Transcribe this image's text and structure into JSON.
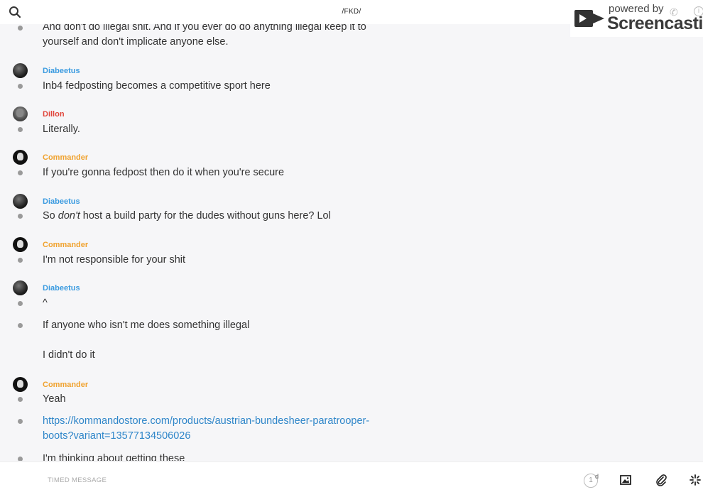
{
  "header": {
    "title": "/FKD/",
    "search_icon": "search-icon"
  },
  "watermark": {
    "powered_by": "powered by",
    "brand": "Screencastify"
  },
  "messages": [
    {
      "type": "text",
      "text": "And don't do illegal shit. And if you ever do do anything illegal keep it to yourself and don't implicate anyone else."
    },
    {
      "type": "author",
      "name": "Diabeetus",
      "color": "#3b9be0"
    },
    {
      "type": "text",
      "text": "Inb4 fedposting becomes a competitive sport here"
    },
    {
      "type": "author",
      "name": "Dillon",
      "color": "#e0453b"
    },
    {
      "type": "text",
      "text": "Literally."
    },
    {
      "type": "author",
      "name": "Commander",
      "color": "#f0a22e"
    },
    {
      "type": "text",
      "text": "If you're gonna fedpost then do it when you're secure"
    },
    {
      "type": "author",
      "name": "Diabeetus",
      "color": "#3b9be0"
    },
    {
      "type": "text",
      "pre": "So ",
      "em": "don't",
      "post": " host a build party for the dudes without guns here? Lol"
    },
    {
      "type": "author",
      "name": "Commander",
      "color": "#f0a22e"
    },
    {
      "type": "text",
      "text": "I'm not responsible for your shit"
    },
    {
      "type": "author",
      "name": "Diabeetus",
      "color": "#3b9be0"
    },
    {
      "type": "text",
      "text": "^"
    },
    {
      "type": "text",
      "text": "If anyone who isn't me does something illegal"
    },
    {
      "type": "text",
      "text": "I didn't do it"
    },
    {
      "type": "author",
      "name": "Commander",
      "color": "#f0a22e"
    },
    {
      "type": "text",
      "text": "Yeah"
    },
    {
      "type": "link",
      "text": "https://kommandostore.com/products/austrian-bundesheer-paratrooper-boots?variant=13577134506026"
    },
    {
      "type": "text",
      "text": "I'm thinking about getting these"
    }
  ],
  "composer": {
    "placeholder": "TIMED MESSAGE",
    "timer_value": "1",
    "timer_unit": "d",
    "icons": [
      "image-icon",
      "paperclip-icon",
      "sparkle-icon"
    ]
  }
}
